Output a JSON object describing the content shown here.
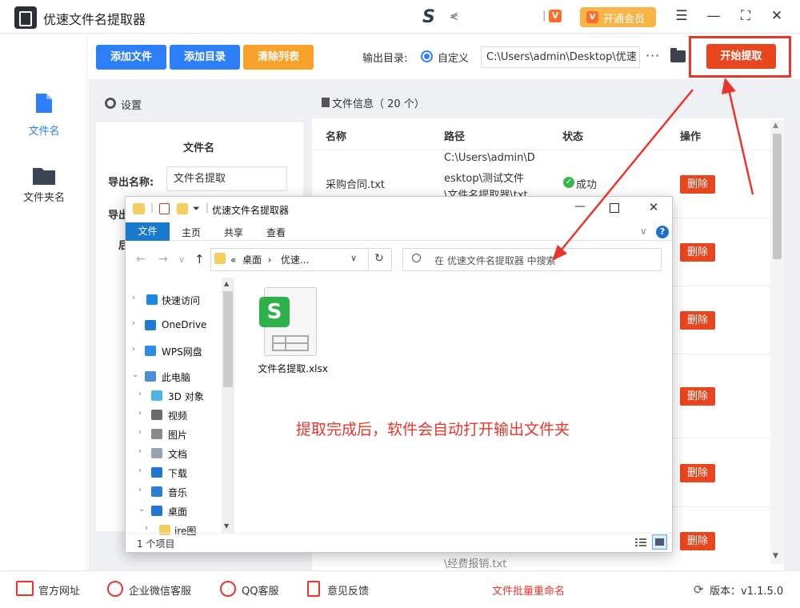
{
  "app": {
    "title": "优速文件名提取器",
    "s_logo": "S",
    "s_logo_tail": "⋞",
    "vip_mini_separator": "|",
    "vip_mini_icon": "V",
    "vip_button_label": "开通会员",
    "vip_button_icon": "V",
    "window_controls": {
      "menu": "☰",
      "minimize": "—",
      "fullscreen": "⛶",
      "close": "✕"
    }
  },
  "nav": {
    "items": [
      {
        "label": "文件名",
        "icon": "document-icon",
        "active": true
      },
      {
        "label": "文件夹名",
        "icon": "folder-icon",
        "active": false
      }
    ]
  },
  "toolbar": {
    "add_file": "添加文件",
    "add_dir": "添加目录",
    "clear_list": "清除列表",
    "output_dir_label": "输出目录:",
    "custom_label": "自定义",
    "output_path": "C:\\Users\\admin\\Desktop\\优速",
    "more": "···",
    "start_button": "开始提取"
  },
  "settings": {
    "title": "设置",
    "section_title": "文件名",
    "export_name_label": "导出名称:",
    "export_name_value": "文件名提取",
    "export_format_label": "导出",
    "clipped_label": "后"
  },
  "file_info": {
    "title": "文件信息（ 20 个）",
    "columns": [
      "名称",
      "路径",
      "状态",
      "操作"
    ],
    "row1": {
      "name": "采购合同.txt",
      "path_lines": [
        "C:\\Users\\admin\\D",
        "esktop\\测试文件",
        "\\文件名提取器\\txt"
      ],
      "status": "成功",
      "status_icon": "✓"
    },
    "delete_label": "删除",
    "tail_text": "\\经费报销.txt"
  },
  "footer": {
    "official_site": "官方网址",
    "wechat_service": "企业微信客服",
    "qq_service": "QQ客服",
    "feedback": "意见反馈",
    "batch_rename": "文件批量重命名",
    "version_label": "版本：v1.1.5.0",
    "version_icon": "⟳"
  },
  "explorer": {
    "title": "优速文件名提取器",
    "quick_access_separator": "|",
    "quick_access_dropdown": "⏷",
    "minimize": "—",
    "close": "✕",
    "tabs": [
      "主页",
      "共享",
      "查看"
    ],
    "file_tab": "文件",
    "ribbon_chevron": "∨",
    "help": "?",
    "nav_back": "←",
    "nav_forward": "→",
    "nav_dropdown": "∨",
    "nav_up": "↑",
    "address": "«  桌面  ›   优速...",
    "address_dropdown": "∨",
    "refresh": "↻",
    "search_placeholder": "在 优速文件名提取器 中搜索",
    "tree": [
      {
        "label": "快速访问",
        "arrow": "›",
        "color": "#1e88e5"
      },
      {
        "label": "OneDrive",
        "arrow": "›",
        "color": "#1e7bd6"
      },
      {
        "label": "WPS网盘",
        "arrow": "›",
        "color": "#2b8be6"
      },
      {
        "label": "此电脑",
        "arrow": "⌄",
        "color": "#4a8fd8"
      },
      {
        "label": "3D 对象",
        "arrow": "›",
        "color": "#4fb3e8"
      },
      {
        "label": "视频",
        "arrow": "›",
        "color": "#6a6a6a"
      },
      {
        "label": "图片",
        "arrow": "›",
        "color": "#8a8a8a"
      },
      {
        "label": "文档",
        "arrow": "›",
        "color": "#9aa4b0"
      },
      {
        "label": "下载",
        "arrow": "›",
        "color": "#1f77d0"
      },
      {
        "label": "音乐",
        "arrow": "›",
        "color": "#2a7fd5"
      },
      {
        "label": "桌面",
        "arrow": "⌄",
        "color": "#1f77d0"
      },
      {
        "label": "ire图",
        "arrow": "›",
        "color": "#f3cf62"
      }
    ],
    "tree_scroll_up": "▲",
    "tree_scroll_down": "▼",
    "file_badge": "S",
    "file_name": "文件名提取.xlsx",
    "hint": "提取完成后，软件会自动打开输出文件夹",
    "status": "1 个项目"
  },
  "scroll": {
    "up": "▲",
    "down": "▼"
  },
  "colors": {
    "blue_button": "#2d7ff9",
    "orange_button": "#f7a22b",
    "red_accent": "#e8362d",
    "delete_button": "#e8461f",
    "success": "#3bb54a"
  }
}
